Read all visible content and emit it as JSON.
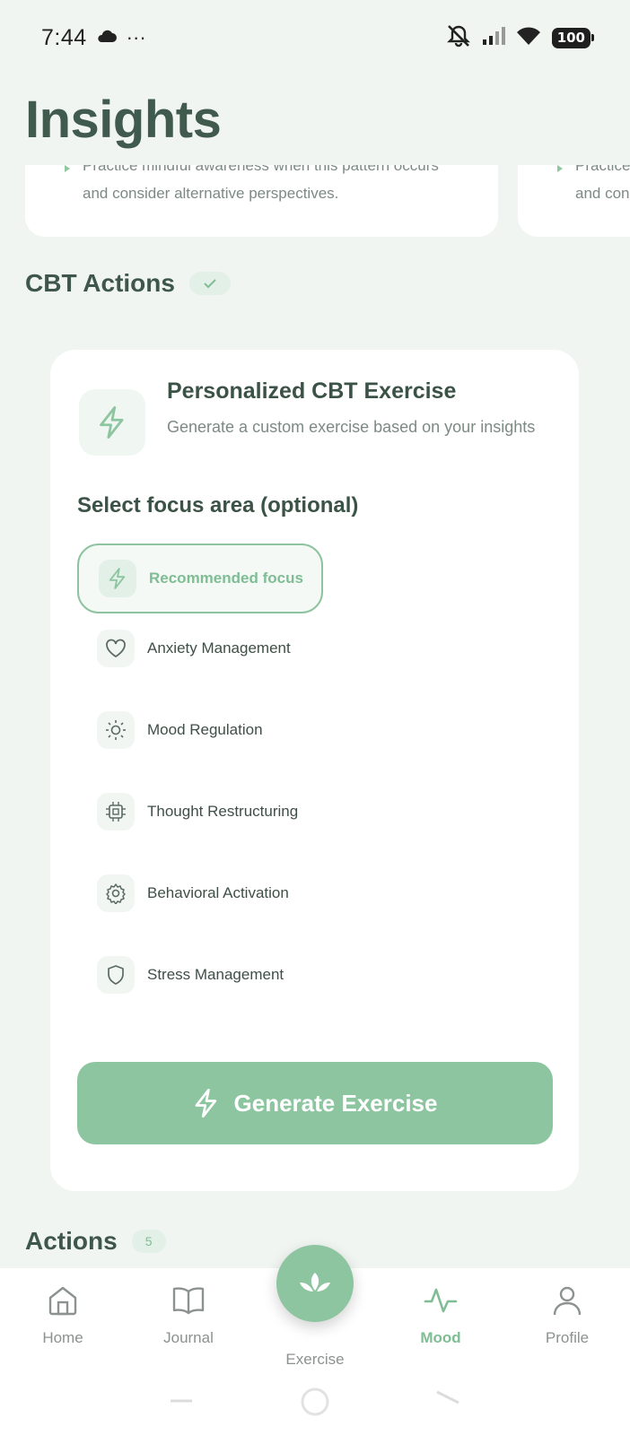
{
  "status_bar": {
    "time": "7:44",
    "more": "···",
    "battery": "100"
  },
  "page": {
    "title": "Insights"
  },
  "insight_cards": [
    {
      "line_partial": "Practice mindful awareness when this pattern occurs",
      "line": "and consider alternative perspectives."
    },
    {
      "line_partial": "Practice",
      "line": "and con"
    }
  ],
  "cbt_section": {
    "title": "CBT Actions"
  },
  "exercise_card": {
    "title": "Personalized CBT Exercise",
    "description": "Generate a custom exercise based on your insights",
    "focus_heading": "Select focus area (optional)",
    "focus_options": [
      {
        "label": "Recommended focus",
        "icon": "lightning-icon",
        "selected": true
      },
      {
        "label": "Anxiety Management",
        "icon": "heart-icon",
        "selected": false
      },
      {
        "label": "Mood Regulation",
        "icon": "sun-icon",
        "selected": false
      },
      {
        "label": "Thought Restructuring",
        "icon": "chip-icon",
        "selected": false
      },
      {
        "label": "Behavioral Activation",
        "icon": "gear-icon",
        "selected": false
      },
      {
        "label": "Stress Management",
        "icon": "shield-icon",
        "selected": false
      }
    ],
    "generate_label": "Generate Exercise"
  },
  "actions_section": {
    "title": "Actions",
    "count": "5"
  },
  "nav": {
    "home": "Home",
    "journal": "Journal",
    "exercise": "Exercise",
    "mood": "Mood",
    "profile": "Profile",
    "active": "mood"
  },
  "colors": {
    "accent": "#8dc5a0",
    "accent_text": "#7fbd94",
    "background": "#f0f5f2",
    "heading": "#415a4e"
  }
}
